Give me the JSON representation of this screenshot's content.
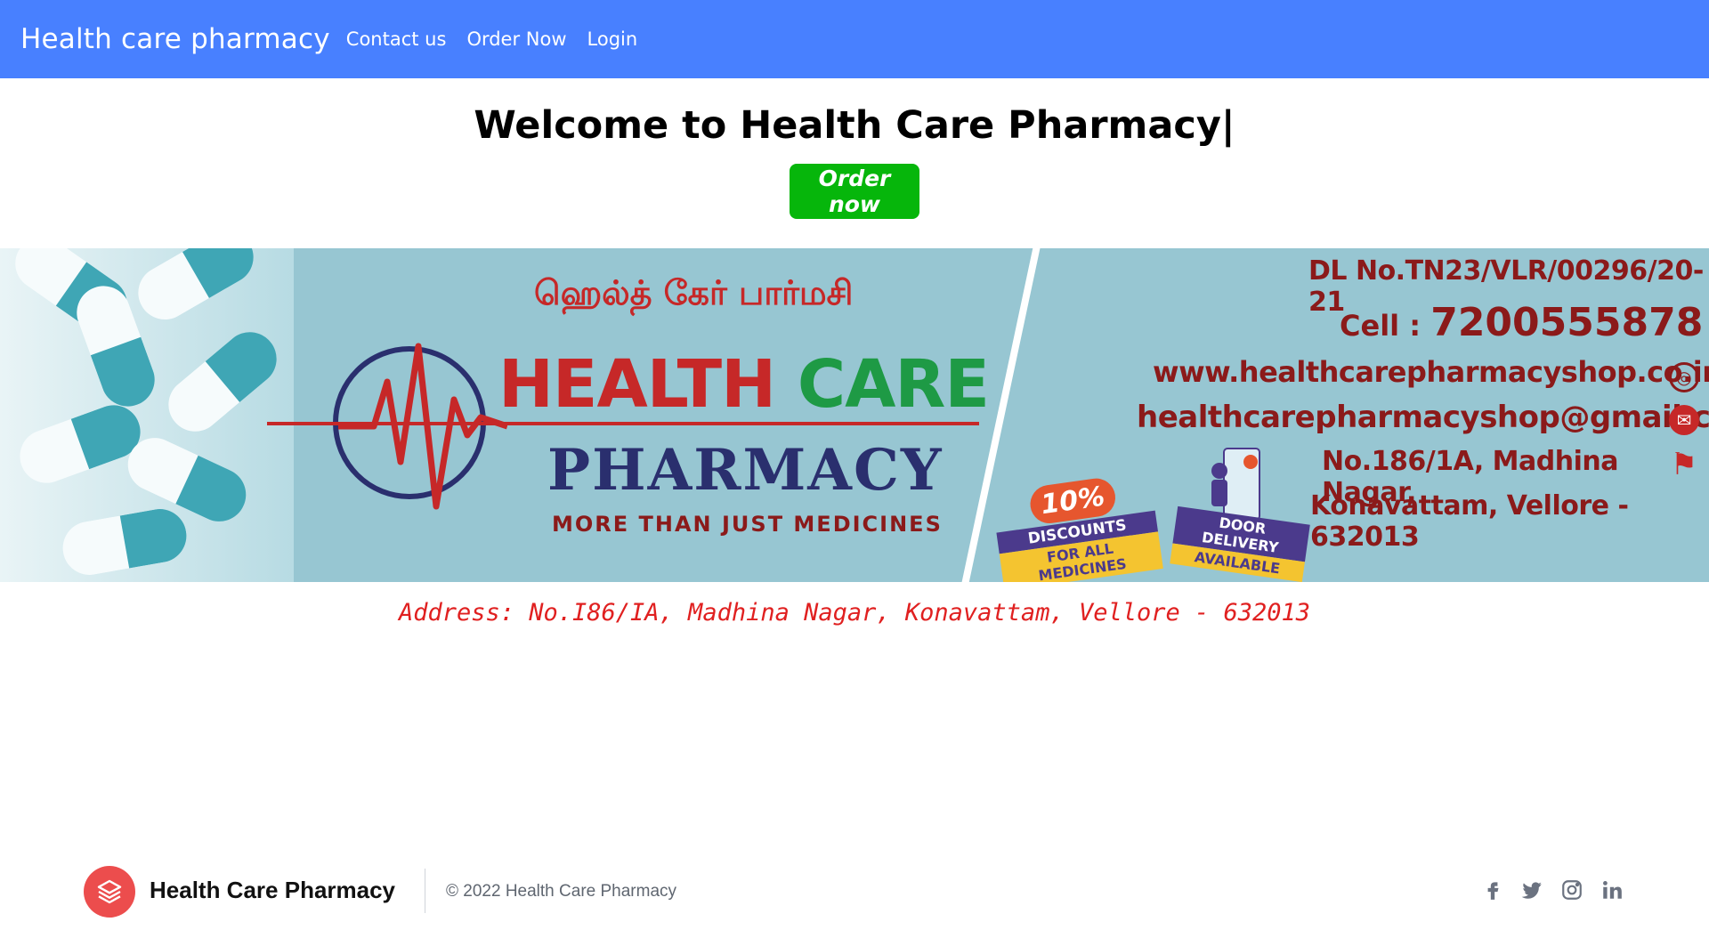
{
  "navbar": {
    "brand": "Health care pharmacy",
    "links": [
      "Contact us",
      "Order Now",
      "Login"
    ]
  },
  "hero": {
    "title": "Welcome to Health Care Pharmacy|",
    "order_button": "Order now"
  },
  "banner": {
    "tamil_name": "ஹெல்த் கேர் பார்மசி",
    "title_part1": "HEALTH",
    "title_part2": "CARE",
    "subtitle": "PHARMACY",
    "tagline": "MORE THAN JUST MEDICINES",
    "dl_no": "DL No.TN23/VLR/00296/20-21",
    "cell_label": "Cell : ",
    "cell_number": "7200555878",
    "website": "www.healthcarepharmacyshop.co.in",
    "email": "healthcarepharmacyshop@gmail.com",
    "address_line1": "No.186/1A, Madhina Nagar,",
    "address_line2": "Konavattam, Vellore - 632013",
    "discount_pct": "10%",
    "discount_line1": "DISCOUNTS",
    "discount_line2": "FOR ALL MEDICINES",
    "delivery_line1": "DOOR DELIVERY",
    "delivery_line2": "AVAILABLE"
  },
  "address_text": "Address: No.I86/IA, Madhina Nagar, Konavattam, Vellore - 632013",
  "footer": {
    "brand": "Health Care Pharmacy",
    "copyright": "© 2022 Health Care Pharmacy",
    "social_icons": [
      "facebook-icon",
      "twitter-icon",
      "instagram-icon",
      "linkedin-icon"
    ]
  },
  "colors": {
    "navbar": "#4880ff",
    "order_button": "#06b60b",
    "address_text": "#e02020",
    "footer_logo": "#ec4d4d"
  }
}
